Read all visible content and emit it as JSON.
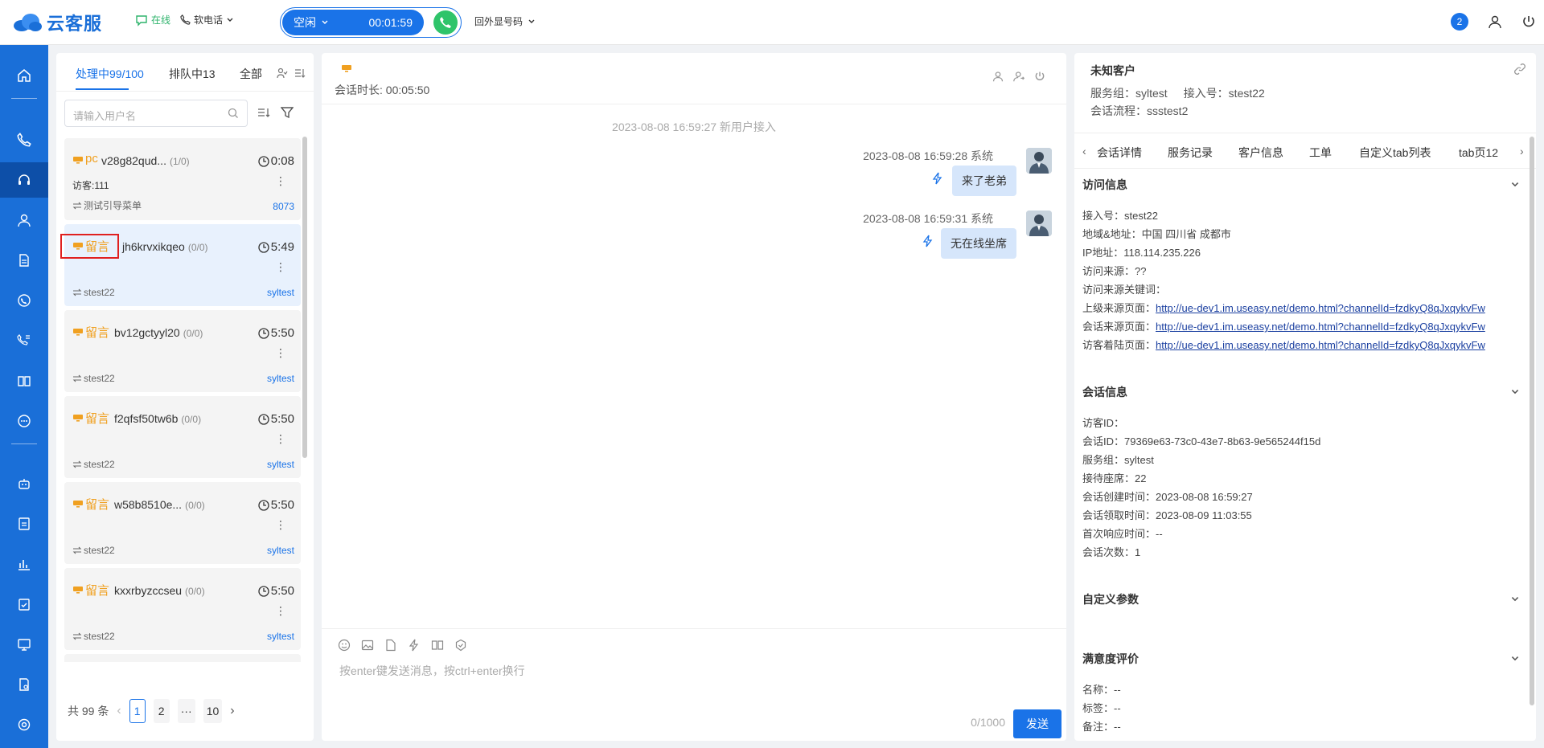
{
  "app": {
    "name": "云客服"
  },
  "header": {
    "status_label": "在线",
    "phone_label": "软电话",
    "call_state": "空闲",
    "call_timer": "00:01:59",
    "outbound_label": "回外显号码",
    "notification_count": "2"
  },
  "left": {
    "tabs": [
      {
        "label": "处理中99/100"
      },
      {
        "label": "排队中13"
      },
      {
        "label": "全部"
      }
    ],
    "search_placeholder": "请输入用户名",
    "sessions": [
      {
        "source": "pc",
        "name": "v28g82qud...",
        "count": "(1/0)",
        "time": "0:08",
        "line2": "访客:111",
        "group": "测试引导菜单",
        "tag": "8073"
      },
      {
        "source": "留言",
        "name": "jh6krvxikqeo",
        "count": "(0/0)",
        "time": "5:49",
        "line2": "",
        "group": "stest22",
        "tag": "syltest"
      },
      {
        "source": "留言",
        "name": "bv12gctyyl20",
        "count": "(0/0)",
        "time": "5:50",
        "line2": "",
        "group": "stest22",
        "tag": "syltest"
      },
      {
        "source": "留言",
        "name": "f2qfsf50tw6b",
        "count": "(0/0)",
        "time": "5:50",
        "line2": "",
        "group": "stest22",
        "tag": "syltest"
      },
      {
        "source": "留言",
        "name": "w58b8510e...",
        "count": "(0/0)",
        "time": "5:50",
        "line2": "",
        "group": "stest22",
        "tag": "syltest"
      },
      {
        "source": "留言",
        "name": "kxxrbyzccseu",
        "count": "(0/0)",
        "time": "5:50",
        "line2": "",
        "group": "stest22",
        "tag": "syltest"
      }
    ],
    "pagination": {
      "total": "共 99 条",
      "pages": [
        "1",
        "2",
        "···",
        "10"
      ],
      "current": "1"
    }
  },
  "center": {
    "duration": "会话时长: 00:05:50",
    "system_message": "2023-08-08 16:59:27 新用户接入",
    "messages": [
      {
        "meta": "2023-08-08 16:59:28 系统",
        "text": "来了老弟"
      },
      {
        "meta": "2023-08-08 16:59:31 系统",
        "text": "无在线坐席"
      }
    ],
    "input_placeholder": "按enter键发送消息，按ctrl+enter换行",
    "counter": "0/1000",
    "send_label": "发送"
  },
  "right": {
    "customer_title": "未知客户",
    "service_group": "服务组：syltest",
    "access_no": "接入号：stest22",
    "flow": "会话流程：ssstest2",
    "tabs": [
      "会话详情",
      "服务记录",
      "客户信息",
      "工单",
      "自定义tab列表",
      "tab页12"
    ],
    "visit_info": {
      "title": "访问信息",
      "rows": [
        {
          "label": "接入号：",
          "value": "stest22"
        },
        {
          "label": "地域&地址：",
          "value": "中国 四川省 成都市"
        },
        {
          "label": "IP地址：",
          "value": "118.114.235.226"
        },
        {
          "label": "访问来源：",
          "value": "??"
        },
        {
          "label": "访问来源关键词：",
          "value": ""
        },
        {
          "label": "上级来源页面：",
          "value": "http://ue-dev1.im.useasy.net/demo.html?channelId=fzdkyQ8qJxqykvFw",
          "link": true
        },
        {
          "label": "会话来源页面：",
          "value": "http://ue-dev1.im.useasy.net/demo.html?channelId=fzdkyQ8qJxqykvFw",
          "link": true
        },
        {
          "label": "访客着陆页面：",
          "value": "http://ue-dev1.im.useasy.net/demo.html?channelId=fzdkyQ8qJxqykvFw",
          "link": true
        }
      ]
    },
    "session_info": {
      "title": "会话信息",
      "rows": [
        {
          "label": "访客ID：",
          "value": ""
        },
        {
          "label": "会话ID：",
          "value": "79369e63-73c0-43e7-8b63-9e565244f15d"
        },
        {
          "label": "服务组：",
          "value": "syltest"
        },
        {
          "label": "接待座席：",
          "value": "22"
        },
        {
          "label": "会话创建时间：",
          "value": "2023-08-08 16:59:27"
        },
        {
          "label": "会话领取时间：",
          "value": "2023-08-09 11:03:55"
        },
        {
          "label": "首次响应时间：",
          "value": "--"
        },
        {
          "label": "会话次数：",
          "value": "1"
        }
      ]
    },
    "custom_params": {
      "title": "自定义参数"
    },
    "satisfaction": {
      "title": "满意度评价",
      "rows": [
        {
          "label": "名称：",
          "value": "--"
        },
        {
          "label": "标签：",
          "value": "--"
        },
        {
          "label": "备注：",
          "value": "--"
        }
      ]
    }
  },
  "colors": {
    "primary": "#1a73e8",
    "sidebar": "#1a6fd8",
    "sidebar_active": "#0d4fa8",
    "accent_orange": "#f0a020",
    "online_green": "#2db36b",
    "call_green": "#2fc46a",
    "highlight_red": "#e02020"
  }
}
